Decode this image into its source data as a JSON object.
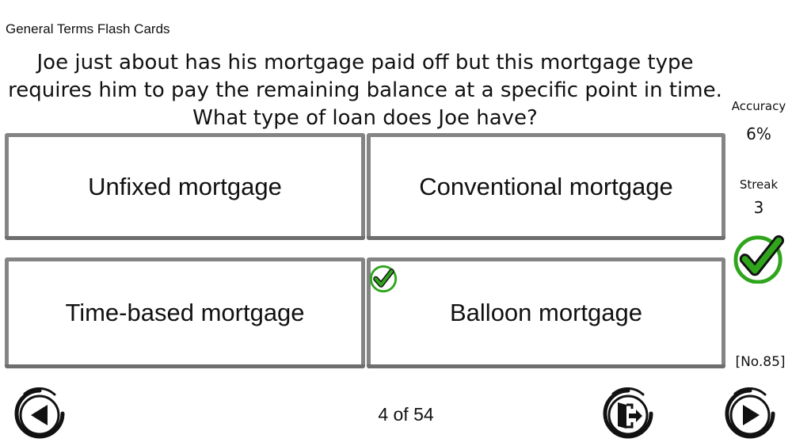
{
  "deck": {
    "title": "General Terms Flash Cards"
  },
  "question": {
    "lines": [
      "Joe just about has his mortgage paid off but this mortgage type",
      "requires him to pay the remaining balance at a specific point in time.",
      "What type of loan does Joe have?"
    ]
  },
  "answers": [
    {
      "label": "Unfixed mortgage",
      "correct": false
    },
    {
      "label": "Conventional mortgage",
      "correct": false
    },
    {
      "label": "Time-based mortgage",
      "correct": false
    },
    {
      "label": "Balloon mortgage",
      "correct": true
    }
  ],
  "stats": {
    "accuracy_label": "Accuracy",
    "accuracy_value": "6%",
    "streak_label": "Streak",
    "streak_value": "3",
    "card_number": "[No.85]"
  },
  "progress": {
    "text": "4 of 54"
  },
  "icons": {
    "correct_mark": "check-circle-icon",
    "prev": "arrow-left-circle-icon",
    "exit": "exit-door-icon",
    "next": "arrow-right-circle-icon"
  },
  "colors": {
    "card_border": "#848484",
    "check_green": "#2fa51c",
    "icon_dark": "#111111"
  }
}
